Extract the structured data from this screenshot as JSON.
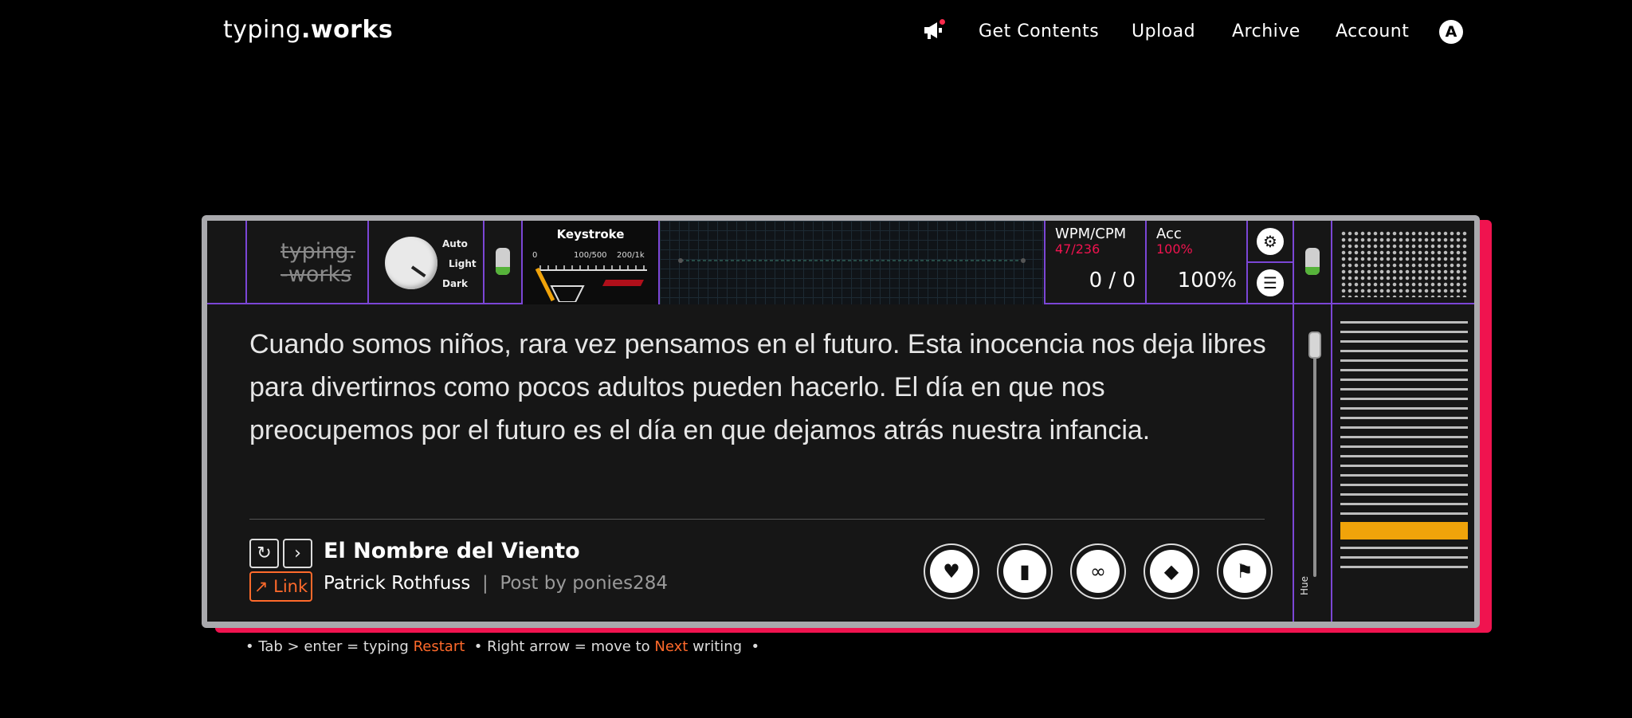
{
  "nav": {
    "logo_light": "typing",
    "logo_bold": ".works",
    "links": [
      "Get Contents",
      "Upload",
      "Archive",
      "Account"
    ],
    "avatar_letter": "A"
  },
  "device": {
    "brand_top": "typing.",
    "brand_bottom": "-works",
    "theme_options": [
      "Auto",
      "Light",
      "Dark"
    ],
    "keystroke": {
      "title": "Keystroke",
      "ticks": [
        "0",
        "100/500",
        "200/1k"
      ]
    },
    "wpm": {
      "label": "WPM/CPM",
      "value": "47/236",
      "current": "0 / 0"
    },
    "acc": {
      "label": "Acc",
      "value": "100%",
      "current": "100%"
    },
    "hue_label": "Hue",
    "colors": {
      "accent": "#f0134f",
      "border": "#7b46d6",
      "highlight": "#f0a30a",
      "link": "#ff6a2b"
    }
  },
  "passage": {
    "text": "Cuando somos niños, rara vez pensamos en el futuro. Esta inocencia nos deja libres para divertirnos como pocos adultos pueden hacerlo. El día en que nos preocupemos por el futuro es el día en que dejamos atrás nuestra infancia."
  },
  "meta": {
    "title": "El Nombre del Viento",
    "author": "Patrick Rothfuss",
    "post_by": "Post by ponies284",
    "link_label": "Link"
  },
  "hints": {
    "a": "Tab > enter = typing",
    "restart": "Restart",
    "b": "Right arrow = move to",
    "next": "Next",
    "c": "writing"
  }
}
